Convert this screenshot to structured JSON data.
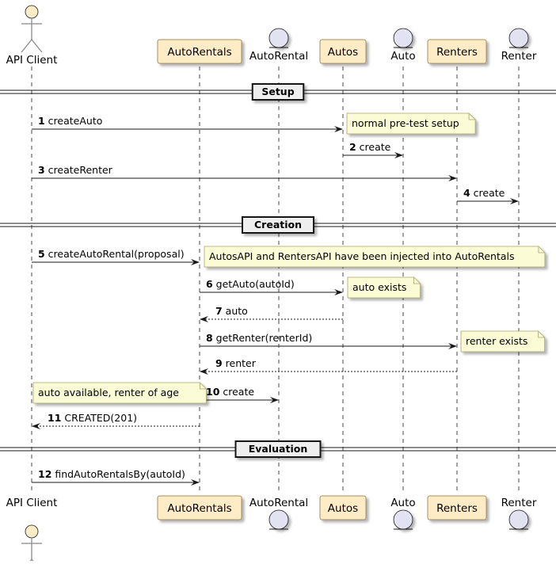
{
  "participants": [
    {
      "id": "client",
      "name": "API Client",
      "type": "actor"
    },
    {
      "id": "rentals",
      "name": "AutoRentals",
      "type": "participant"
    },
    {
      "id": "rental",
      "name": "AutoRental",
      "type": "entity"
    },
    {
      "id": "autos",
      "name": "Autos",
      "type": "participant"
    },
    {
      "id": "auto",
      "name": "Auto",
      "type": "entity"
    },
    {
      "id": "renters",
      "name": "Renters",
      "type": "participant"
    },
    {
      "id": "renter",
      "name": "Renter",
      "type": "entity"
    }
  ],
  "dividers": [
    {
      "label": "Setup"
    },
    {
      "label": "Creation"
    },
    {
      "label": "Evaluation"
    }
  ],
  "messages": [
    {
      "num": "1",
      "label": "createAuto",
      "from": "client",
      "to": "autos",
      "dashed": false
    },
    {
      "num": "2",
      "label": "create",
      "from": "autos",
      "to": "auto",
      "dashed": false
    },
    {
      "num": "3",
      "label": "createRenter",
      "from": "client",
      "to": "renters",
      "dashed": false
    },
    {
      "num": "4",
      "label": "create",
      "from": "renters",
      "to": "renter",
      "dashed": false
    },
    {
      "num": "5",
      "label": "createAutoRental(proposal)",
      "from": "client",
      "to": "rentals",
      "dashed": false
    },
    {
      "num": "6",
      "label": "getAuto(autoId)",
      "from": "rentals",
      "to": "autos",
      "dashed": false
    },
    {
      "num": "7",
      "label": "auto",
      "from": "autos",
      "to": "rentals",
      "dashed": true
    },
    {
      "num": "8",
      "label": "getRenter(renterId)",
      "from": "rentals",
      "to": "renters",
      "dashed": false
    },
    {
      "num": "9",
      "label": "renter",
      "from": "renters",
      "to": "rentals",
      "dashed": true
    },
    {
      "num": "10",
      "label": "create",
      "from": "rentals",
      "to": "rental",
      "dashed": false
    },
    {
      "num": "11",
      "label": "CREATED(201)",
      "from": "rentals",
      "to": "client",
      "dashed": true
    },
    {
      "num": "12",
      "label": "findAutoRentalsBy(autoId)",
      "from": "client",
      "to": "rentals",
      "dashed": false
    }
  ],
  "notes": [
    {
      "text": "normal pre-test setup"
    },
    {
      "text": "AutosAPI and RentersAPI have been injected into AutoRentals"
    },
    {
      "text": "auto exists"
    },
    {
      "text": "renter exists"
    },
    {
      "text": "auto available, renter of age"
    }
  ],
  "colors": {
    "participant_fill": "#FEECC6",
    "participant_border": "#A78B5B",
    "entity_fill": "#E2E2F0",
    "note_fill": "#FBFBD6",
    "note_border": "#A5A56E",
    "divider_fill": "#EEEEEE",
    "line": "#181818"
  }
}
